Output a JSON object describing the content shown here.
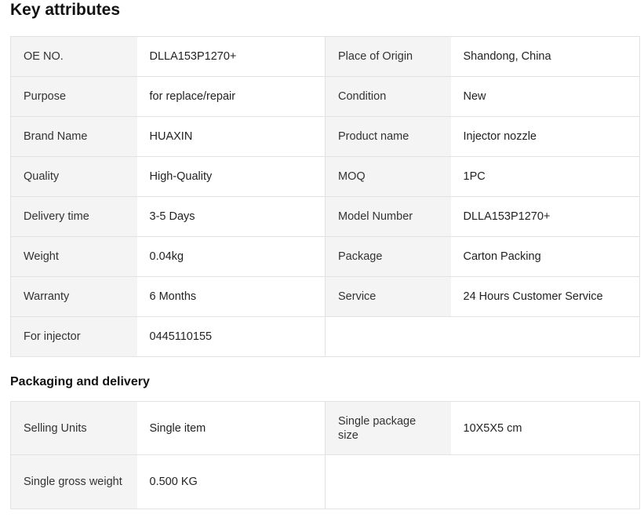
{
  "key_attributes": {
    "title": "Key attributes",
    "rows": [
      [
        {
          "k": "OE NO.",
          "v": "DLLA153P1270+"
        },
        {
          "k": "Place of Origin",
          "v": "Shandong, China"
        }
      ],
      [
        {
          "k": "Purpose",
          "v": "for replace/repair"
        },
        {
          "k": "Condition",
          "v": "New"
        }
      ],
      [
        {
          "k": "Brand Name",
          "v": "HUAXIN"
        },
        {
          "k": "Product name",
          "v": "Injector nozzle"
        }
      ],
      [
        {
          "k": "Quality",
          "v": "High-Quality"
        },
        {
          "k": "MOQ",
          "v": "1PC"
        }
      ],
      [
        {
          "k": "Delivery time",
          "v": "3-5 Days"
        },
        {
          "k": "Model Number",
          "v": "DLLA153P1270+"
        }
      ],
      [
        {
          "k": "Weight",
          "v": "0.04kg"
        },
        {
          "k": "Package",
          "v": "Carton Packing"
        }
      ],
      [
        {
          "k": "Warranty",
          "v": "6 Months"
        },
        {
          "k": "Service",
          "v": "24 Hours Customer Service"
        }
      ],
      [
        {
          "k": "For injector",
          "v": "0445110155"
        }
      ]
    ]
  },
  "packaging": {
    "title": "Packaging and delivery",
    "rows": [
      [
        {
          "k": "Selling Units",
          "v": "Single item"
        },
        {
          "k": "Single package size",
          "v": "10X5X5 cm"
        }
      ],
      [
        {
          "k": "Single gross weight",
          "v": "0.500 KG"
        }
      ]
    ]
  }
}
